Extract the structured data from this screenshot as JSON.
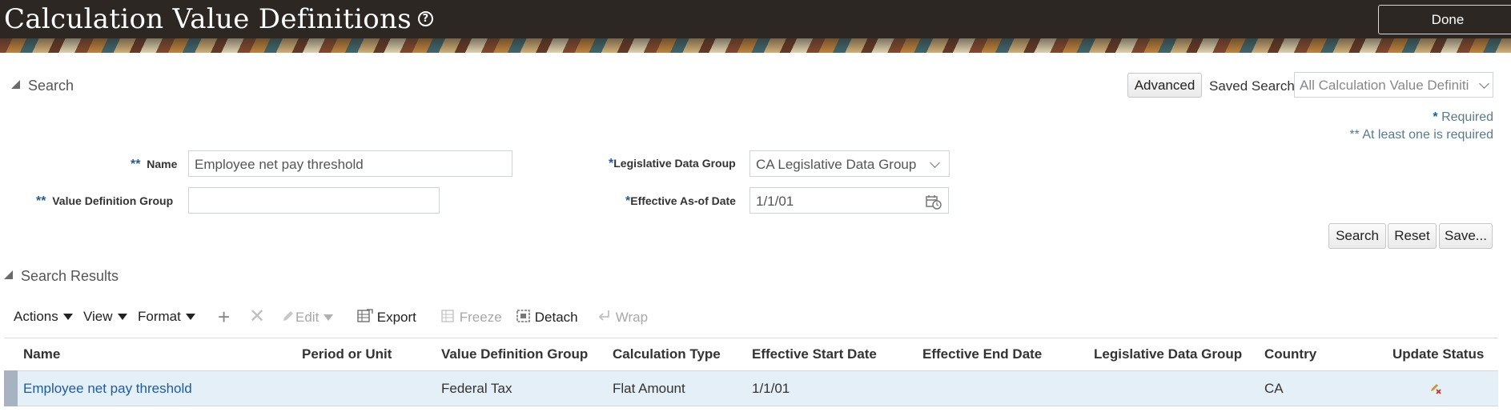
{
  "header": {
    "title": "Calculation Value Definitions",
    "help_icon": "?",
    "done_label": "Done"
  },
  "search": {
    "section_title": "Search",
    "advanced_label": "Advanced",
    "saved_search_label": "Saved Search",
    "saved_search_value": "All Calculation Value Definiti",
    "required_note": "Required",
    "at_least_one_note": "At least one is required",
    "required_marker": "*",
    "at_least_one_marker": "**",
    "fields": {
      "name": {
        "label": "Name",
        "value": "Employee net pay threshold"
      },
      "value_definition_group": {
        "label": "Value Definition Group",
        "value": ""
      },
      "legislative_data_group": {
        "label": "Legislative Data Group",
        "value": "CA Legislative Data Group"
      },
      "effective_as_of_date": {
        "label": "Effective As-of Date",
        "value": "1/1/01"
      }
    },
    "buttons": {
      "search": "Search",
      "reset": "Reset",
      "save": "Save..."
    }
  },
  "results": {
    "section_title": "Search Results",
    "toolbar": {
      "actions": "Actions",
      "view": "View",
      "format": "Format",
      "edit": "Edit",
      "export": "Export",
      "freeze": "Freeze",
      "detach": "Detach",
      "wrap": "Wrap"
    },
    "columns": [
      "Name",
      "Period or Unit",
      "Value Definition Group",
      "Calculation Type",
      "Effective Start Date",
      "Effective End Date",
      "Legislative Data Group",
      "Country",
      "Update Status"
    ],
    "rows": [
      {
        "name": "Employee net pay threshold",
        "period_or_unit": "",
        "value_definition_group": "Federal Tax",
        "calculation_type": "Flat Amount",
        "effective_start_date": "1/1/01",
        "effective_end_date": "",
        "legislative_data_group": "",
        "country": "CA",
        "update_status_icon": "pencil-x-icon"
      }
    ]
  }
}
